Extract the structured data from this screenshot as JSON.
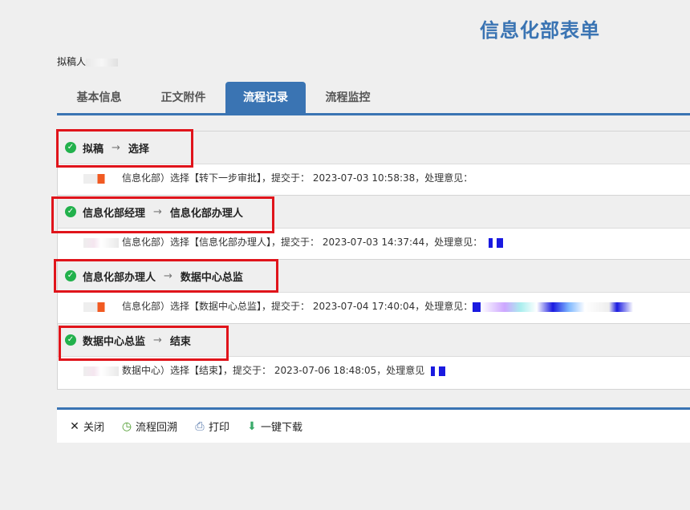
{
  "header": {
    "title": "信息化部表单",
    "drafter_label": "拟稿人"
  },
  "tabs": [
    {
      "label": "基本信息"
    },
    {
      "label": "正文附件"
    },
    {
      "label": "流程记录",
      "active": true
    },
    {
      "label": "流程监控"
    }
  ],
  "records": [
    {
      "from": "拟稿",
      "to": "选择",
      "detail": "信息化部）选择【转下一步审批】，提交于： 2023-07-03 10:58:38，处理意见："
    },
    {
      "from": "信息化部经理",
      "to": "信息化部办理人",
      "detail": "信息化部）选择【信息化部办理人】，提交于： 2023-07-03 14:37:44，处理意见："
    },
    {
      "from": "信息化部办理人",
      "to": "数据中心总监",
      "detail": "信息化部）选择【数据中心总监】，提交于： 2023-07-04 17:40:04，处理意见："
    },
    {
      "from": "数据中心总监",
      "to": "结束",
      "detail": "数据中心）选择【结束】，提交于： 2023-07-06 18:48:05，处理意见"
    }
  ],
  "arrow": "→",
  "footer": {
    "close": "关闭",
    "trace": "流程回溯",
    "print": "打印",
    "download": "一键下载"
  },
  "colors": {
    "accent": "#3a74b3",
    "highlight": "#e0141b",
    "success": "#22b14c"
  }
}
